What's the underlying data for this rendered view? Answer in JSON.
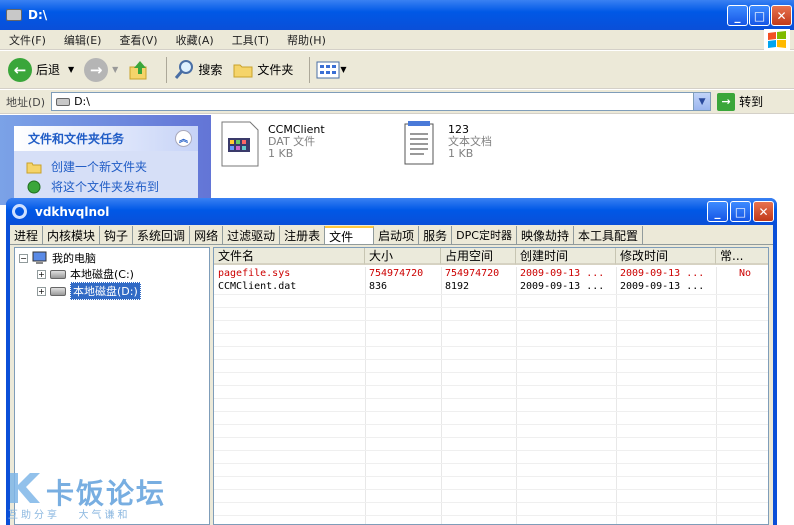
{
  "explorer": {
    "title": "D:\\",
    "menu": [
      "文件(F)",
      "编辑(E)",
      "查看(V)",
      "收藏(A)",
      "工具(T)",
      "帮助(H)"
    ],
    "toolbar": {
      "back": "后退",
      "search": "搜索",
      "folders": "文件夹"
    },
    "address_label": "地址(D)",
    "address_value": "D:\\",
    "go_label": "转到",
    "tasks_title": "文件和文件夹任务",
    "tasks": [
      "创建一个新文件夹",
      "将这个文件夹发布到"
    ],
    "files": [
      {
        "name": "CCMClient",
        "type": "DAT 文件",
        "size": "1 KB"
      },
      {
        "name": "123",
        "type": "文本文档",
        "size": "1 KB"
      }
    ]
  },
  "tool": {
    "title": "vdkhvqlnol",
    "tabs": [
      "进程",
      "内核模块",
      "钩子",
      "系统回调",
      "网络",
      "过滤驱动",
      "注册表",
      "文件",
      "启动项",
      "服务",
      "DPC定时器",
      "映像劫持",
      "本工具配置"
    ],
    "active_tab": "文件",
    "tree": {
      "root": "我的电脑",
      "items": [
        "本地磁盘(C:)",
        "本地磁盘(D:)"
      ]
    },
    "columns": [
      "文件名",
      "大小",
      "占用空间",
      "创建时间",
      "修改时间",
      "常..."
    ],
    "rows": [
      [
        "pagefile.sys",
        "754974720",
        "754974720",
        "2009-09-13 ...",
        "2009-09-13 ...",
        "No"
      ],
      [
        "CCMClient.dat",
        "836",
        "8192",
        "2009-09-13 ...",
        "2009-09-13 ...",
        ""
      ]
    ]
  },
  "watermark": {
    "brand": "卡饭论坛",
    "slogan": "互助分享   大气谦和"
  },
  "colors": {
    "xp_blue": "#0a4fd8",
    "hidden_file_red": "#cc0000",
    "link_blue": "#215dc6"
  }
}
